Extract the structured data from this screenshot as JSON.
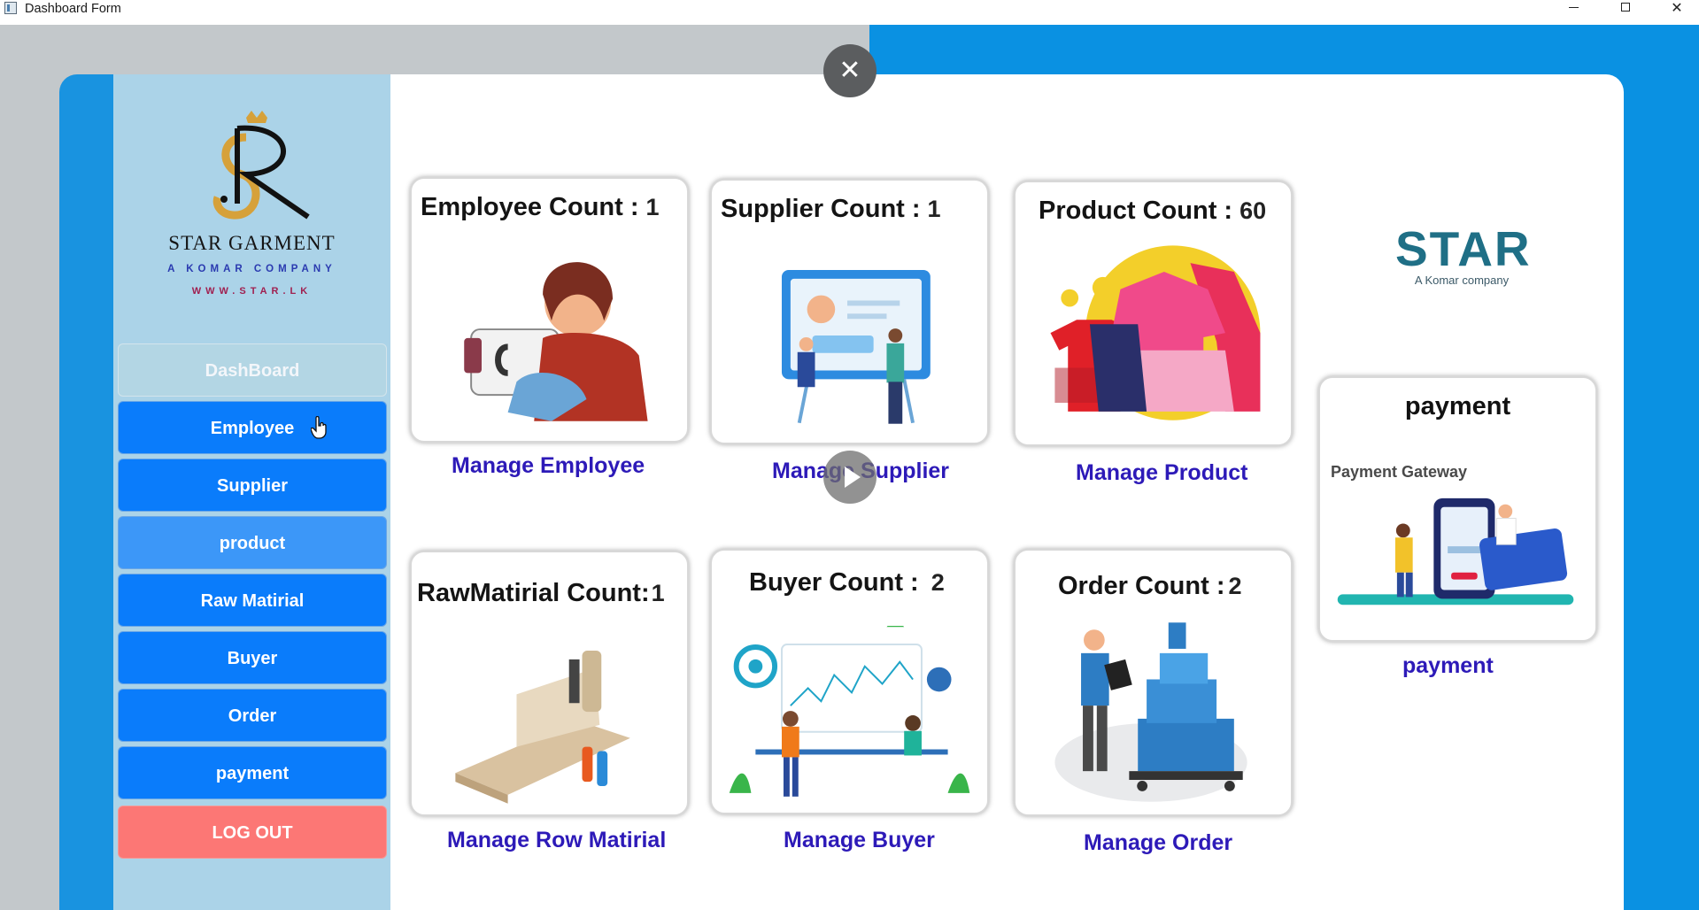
{
  "window": {
    "title": "Dashboard Form",
    "minimize_icon": "minimize-icon",
    "maximize_icon": "maximize-icon",
    "close_icon": "close-icon"
  },
  "brand": {
    "name": "STAR GARMENT",
    "subtitle": "A KOMAR COMPANY",
    "website": "WWW.STAR.LK",
    "logo_letters": "SR"
  },
  "sidebar": {
    "items": [
      {
        "label": "DashBoard"
      },
      {
        "label": "Employee"
      },
      {
        "label": "Supplier"
      },
      {
        "label": "product"
      },
      {
        "label": "Raw Matirial"
      },
      {
        "label": "Buyer"
      },
      {
        "label": "Order"
      },
      {
        "label": "payment"
      },
      {
        "label": "LOG OUT"
      }
    ]
  },
  "tiles": {
    "employee": {
      "label": "Employee Count :",
      "count": "1",
      "link": "Manage Employee"
    },
    "supplier": {
      "label": "Supplier Count :",
      "count": "1",
      "link": "Manage Supplier"
    },
    "product": {
      "label": "Product Count :",
      "count": "60",
      "link": "Manage Product"
    },
    "rawmaterial": {
      "label": "RawMatirial Count:",
      "count": "1",
      "link": "Manage Row Matirial"
    },
    "buyer": {
      "label": "Buyer Count :",
      "count": "2",
      "link": "Manage Buyer"
    },
    "order": {
      "label": "Order Count :",
      "count": "2",
      "link": "Manage Order"
    },
    "payment": {
      "label": "payment",
      "gateway_text": "Payment Gateway",
      "link": "payment"
    }
  },
  "star_logo": {
    "title": "STAR",
    "tagline": "A Komar company"
  },
  "colors": {
    "nav_button": "#0a7cfb",
    "nav_active": "#3c97f8",
    "logout": "#fc7775",
    "link": "#2d1ab8",
    "sidebar_bg": "#abd3e8",
    "frame_blue": "#1993e0"
  }
}
